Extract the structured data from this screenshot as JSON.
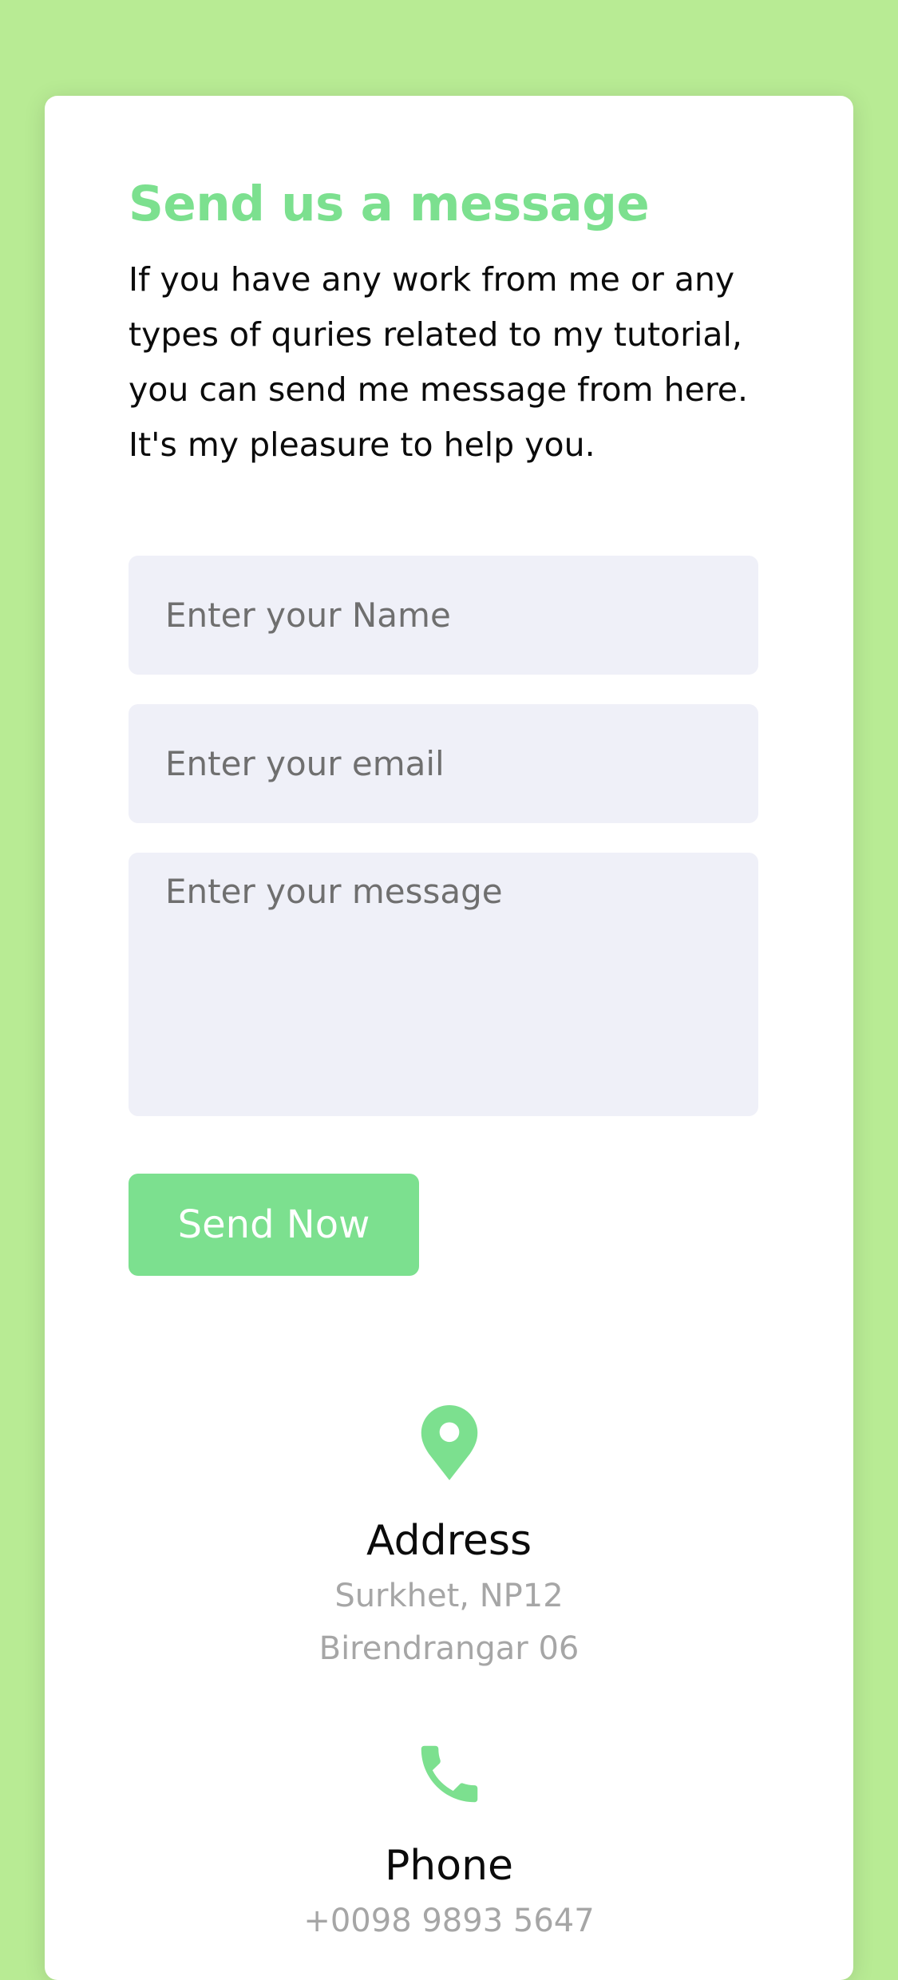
{
  "form": {
    "title": "Send us a message",
    "description": "If you have any work from me or any types of quries related to my tutorial, you can send me message from here. It's my pleasure to help you.",
    "name_placeholder": "Enter your Name",
    "email_placeholder": "Enter your email",
    "message_placeholder": "Enter your message",
    "submit_label": "Send Now"
  },
  "contact": {
    "address": {
      "icon": "map-pin-icon",
      "heading": "Address",
      "line1": "Surkhet, NP12",
      "line2": "Birendrangar 06"
    },
    "phone": {
      "icon": "phone-icon",
      "heading": "Phone",
      "line1": "+0098 9893 5647"
    }
  },
  "colors": {
    "accent": "#7ce08f",
    "background": "#b8eb94",
    "field_background": "#eff0f8"
  }
}
